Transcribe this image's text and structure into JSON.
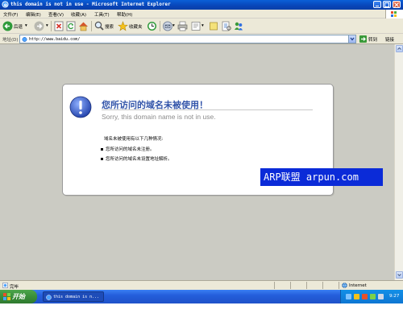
{
  "window": {
    "title": "this domain is not in use - Microsoft Internet Explorer"
  },
  "menu": {
    "items": [
      "文件(F)",
      "编辑(E)",
      "查看(V)",
      "收藏(A)",
      "工具(T)",
      "帮助(H)"
    ]
  },
  "toolbar": {
    "back_label": "后退",
    "search_label": "搜索",
    "favorites_label": "收藏夹",
    "icons": [
      "back-arrow-icon",
      "forward-arrow-icon",
      "stop-icon",
      "refresh-icon",
      "home-icon",
      "search-icon",
      "favorites-star-icon",
      "history-icon",
      "mail-icon",
      "print-icon",
      "edit-icon",
      "discuss-icon",
      "messenger-icon",
      "research-icon"
    ]
  },
  "address": {
    "label": "地址(D)",
    "url": "http://www.baidu.com/",
    "go_label": "转到",
    "links_label": "链接"
  },
  "page": {
    "heading": "您所访问的域名未被使用！",
    "subheading": "Sorry, this domain name is not in use.",
    "intro": "域名未被使用有以下几种情况:",
    "reasons": [
      "您所访问的域名未注册。",
      "您所访问的域名未设置地址解析。"
    ]
  },
  "watermark": "ARP联盟 arpun.com",
  "status": {
    "text": "完毕",
    "zone": "Internet"
  },
  "taskbar": {
    "start_label": "开始",
    "task_label": "this domain is n...",
    "clock": "9:27"
  },
  "colors": {
    "titlebar": "#0845b8",
    "heading": "#3355aa",
    "watermark_bg": "#0b2bd8",
    "content_bg": "#cbcbc3"
  }
}
